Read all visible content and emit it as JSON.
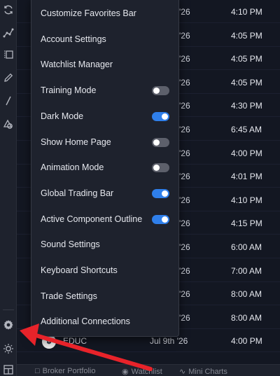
{
  "menu": {
    "items": [
      {
        "label": "Customize Favorites Bar",
        "toggle": null
      },
      {
        "label": "Account Settings",
        "toggle": null
      },
      {
        "label": "Watchlist Manager",
        "toggle": null
      },
      {
        "label": "Training Mode",
        "toggle": false
      },
      {
        "label": "Dark Mode",
        "toggle": true
      },
      {
        "label": "Show Home Page",
        "toggle": false
      },
      {
        "label": "Animation Mode",
        "toggle": false
      },
      {
        "label": "Global Trading Bar",
        "toggle": true
      },
      {
        "label": "Active Component Outline",
        "toggle": true
      },
      {
        "label": "Sound Settings",
        "toggle": null
      },
      {
        "label": "Keyboard Shortcuts",
        "toggle": null
      },
      {
        "label": "Trade Settings",
        "toggle": null
      },
      {
        "label": "Additional Connections",
        "toggle": null
      }
    ]
  },
  "table": {
    "rows": [
      {
        "date": "'26",
        "time": "4:10 PM"
      },
      {
        "date": "'26",
        "time": "4:05 PM"
      },
      {
        "date": "'26",
        "time": "4:05 PM"
      },
      {
        "date": "'26",
        "time": "4:05 PM"
      },
      {
        "date": "'26",
        "time": "4:30 PM"
      },
      {
        "date": "'26",
        "time": "6:45 AM"
      },
      {
        "date": "'26",
        "time": "4:00 PM"
      },
      {
        "date": "'26",
        "time": "4:01 PM"
      },
      {
        "date": "'26",
        "time": "4:10 PM"
      },
      {
        "date": "'26",
        "time": "4:15 PM"
      },
      {
        "date": "'26",
        "time": "6:00 AM"
      },
      {
        "date": "'26",
        "time": "7:00 AM"
      },
      {
        "date": "'26",
        "time": "8:00 AM"
      },
      {
        "date": "'26",
        "time": "8:00 AM"
      },
      {
        "symbol": "EDUC",
        "date": "Jul 9th '26",
        "time": "4:00 PM"
      }
    ]
  },
  "bottom_tabs": [
    "Broker Portfolio",
    "Watchlist",
    "Mini Charts"
  ],
  "sidebar_icons": [
    "refresh-icon",
    "trend-line-icon",
    "layers-icon",
    "pencil-icon",
    "line-tool-icon",
    "shapes-icon",
    "gear-icon",
    "brightness-icon",
    "grid-icon"
  ],
  "colors": {
    "accent": "#2f7fea",
    "annotation": "#e8232a"
  }
}
